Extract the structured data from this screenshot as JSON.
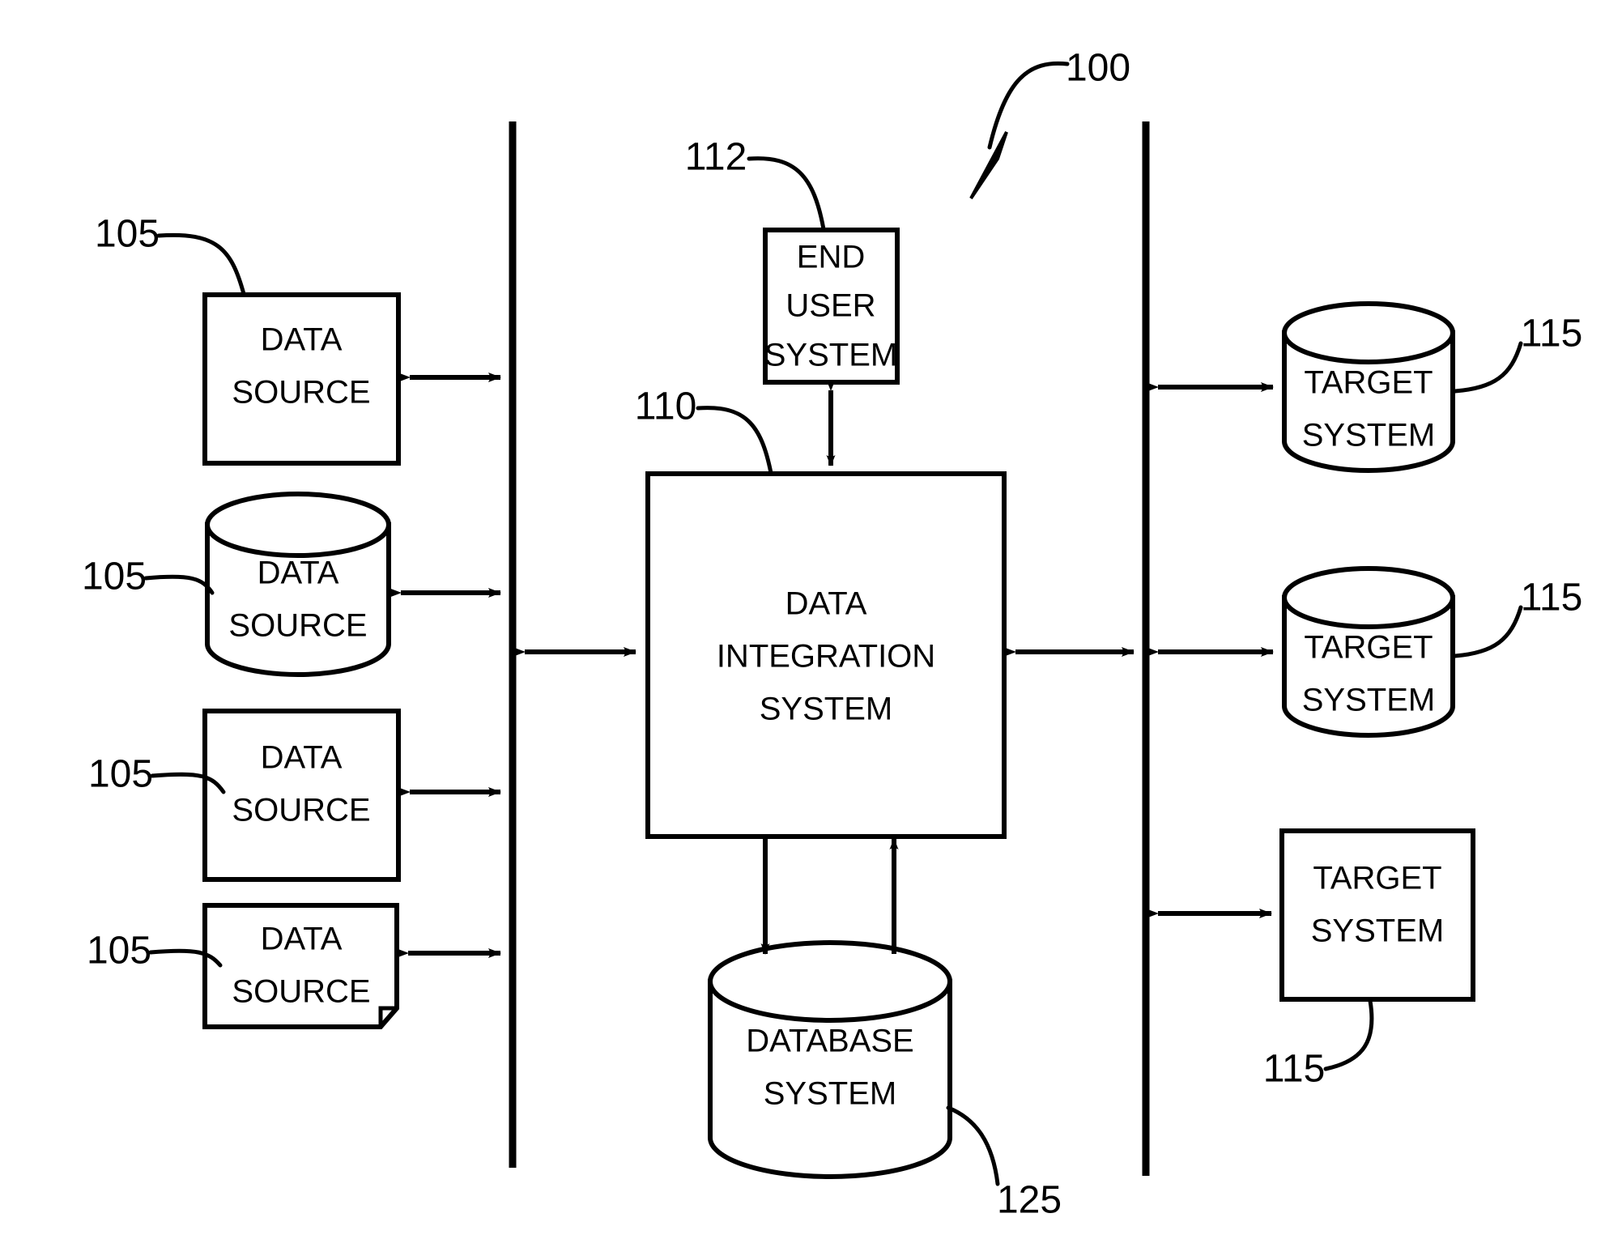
{
  "figure": {
    "title": "Data integration system block diagram",
    "ref_overall": "100",
    "background_color": "#ffffff",
    "line_color": "#000000"
  },
  "data_sources": [
    {
      "ref": "105",
      "label_line1": "DATA",
      "label_line2": "SOURCE",
      "shape": "rectangle"
    },
    {
      "ref": "105",
      "label_line1": "DATA",
      "label_line2": "SOURCE",
      "shape": "cylinder"
    },
    {
      "ref": "105",
      "label_line1": "DATA",
      "label_line2": "SOURCE",
      "shape": "rectangle"
    },
    {
      "ref": "105",
      "label_line1": "DATA",
      "label_line2": "SOURCE",
      "shape": "document"
    }
  ],
  "center": {
    "end_user_system": {
      "ref": "112",
      "label_line1": "END",
      "label_line2": "USER",
      "label_line3": "SYSTEM",
      "shape": "rectangle"
    },
    "data_integration_system": {
      "ref": "110",
      "label_line1": "DATA",
      "label_line2": "INTEGRATION",
      "label_line3": "SYSTEM",
      "shape": "rectangle"
    },
    "database_system": {
      "ref": "125",
      "label_line1": "DATABASE",
      "label_line2": "SYSTEM",
      "shape": "cylinder"
    }
  },
  "target_systems": [
    {
      "ref": "115",
      "label_line1": "TARGET",
      "label_line2": "SYSTEM",
      "shape": "cylinder"
    },
    {
      "ref": "115",
      "label_line1": "TARGET",
      "label_line2": "SYSTEM",
      "shape": "cylinder"
    },
    {
      "ref": "115",
      "label_line1": "TARGET",
      "label_line2": "SYSTEM",
      "shape": "rectangle"
    }
  ]
}
